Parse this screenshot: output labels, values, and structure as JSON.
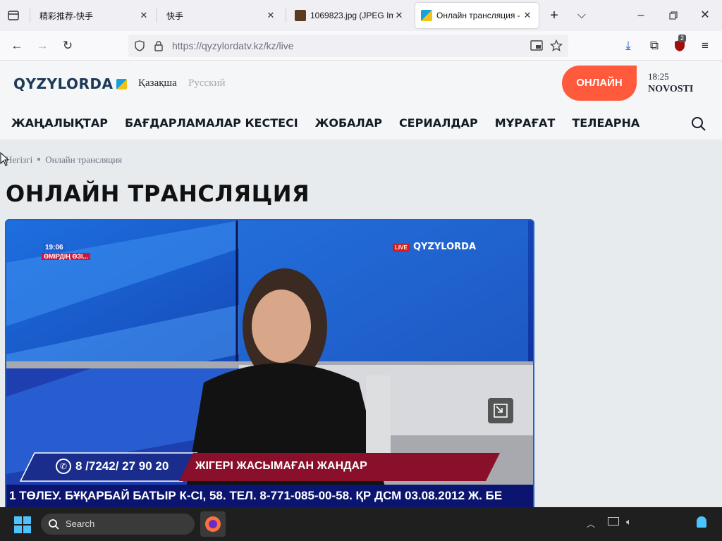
{
  "browser": {
    "tabs": [
      {
        "title": "精彩推荐-快手",
        "active": false
      },
      {
        "title": "快手",
        "active": false
      },
      {
        "title": "1069823.jpg (JPEG Imag",
        "active": false
      },
      {
        "title": "Онлайн трансляция - ",
        "active": true
      }
    ],
    "url_host": "https://qyzylordatv.kz",
    "url_path": "/kz/live",
    "extension_badge": "2"
  },
  "site": {
    "logo": "QYZYLORDA",
    "lang_active": "Қазақша",
    "lang_other": "Русский",
    "online_button": "ОНЛАЙН",
    "now_time": "18:25",
    "now_show": "NOVOSTI",
    "menu": [
      "ЖАҢАЛЫҚТАР",
      "БАҒДАРЛАМАЛАР КЕСТЕСІ",
      "ЖОБАЛАР",
      "СЕРИАЛДАР",
      "МҰРАҒАТ",
      "ТЕЛЕАРНА"
    ]
  },
  "breadcrumb": {
    "home": "Негізгі",
    "current": "Онлайн трансляция"
  },
  "page_title": "ОНЛАЙН ТРАНСЛЯЦИЯ",
  "video": {
    "clock": "19:06",
    "program_tag": "ӨМІРДІҢ ӨЗІ...",
    "live_label": "LIVE",
    "channel_logo": "QYZYLORDA",
    "phone": "8 /7242/ 27 90 20",
    "lower_third": "ЖІГЕРІ ЖАСЫМАҒАН ЖАНДАР",
    "ticker": "1 ТӨЛЕУ. БҰҚАРБАЙ БАТЫР К-СІ, 58. ТЕЛ. 8-771-085-00-58. ҚР ДСМ 03.08.2012 Ж. БЕ"
  },
  "taskbar": {
    "search_placeholder": "Search"
  },
  "colors": {
    "accent": "#ff5a3c",
    "brand": "#1d3a58",
    "player_border": "#1d63c7"
  }
}
